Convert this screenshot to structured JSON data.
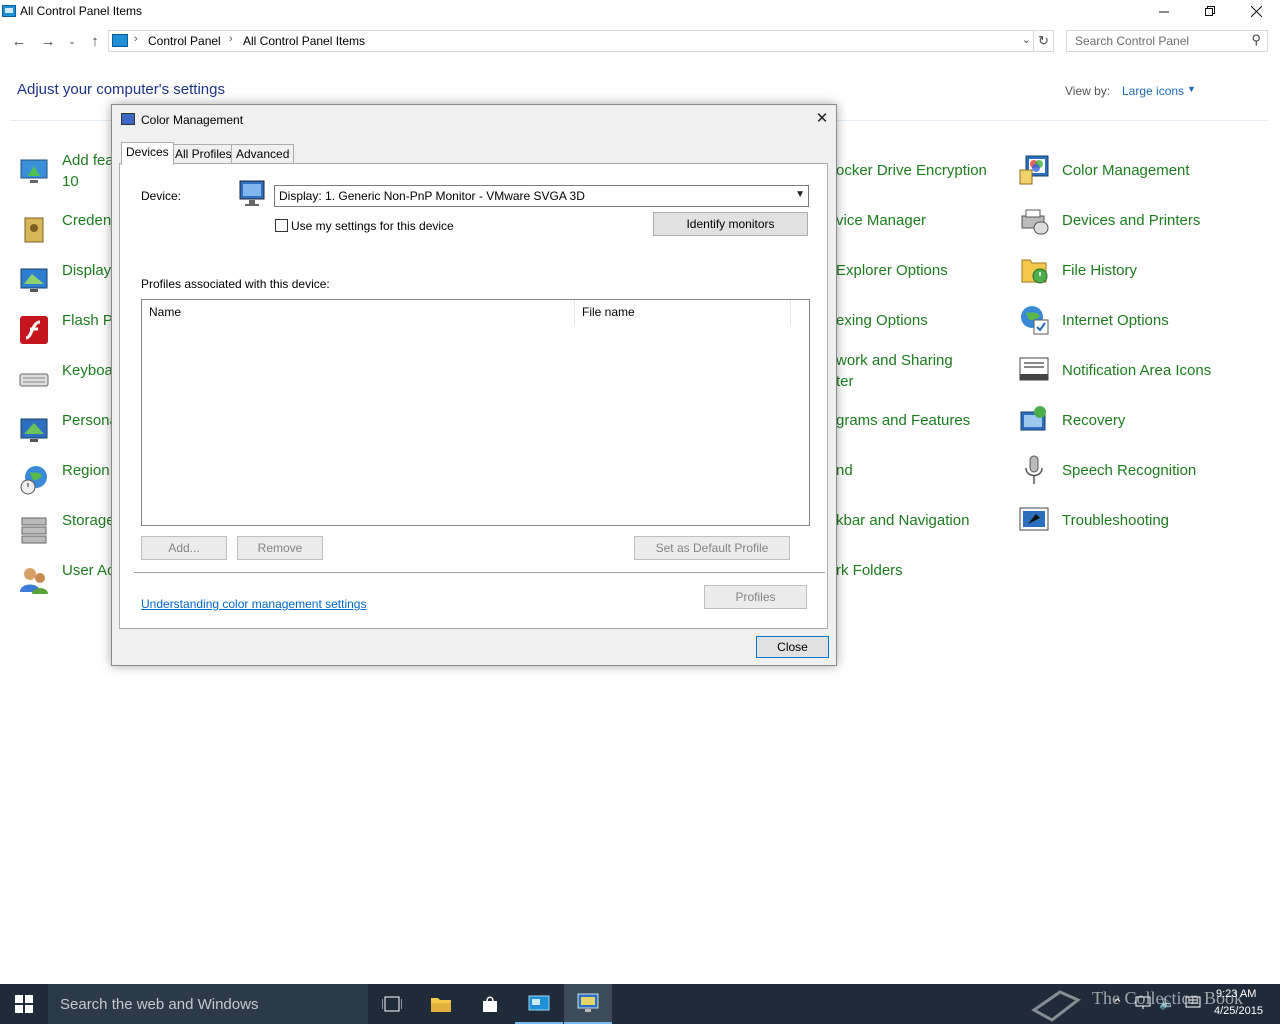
{
  "window": {
    "title": "All Control Panel Items"
  },
  "address": {
    "crumbs": [
      "Control Panel",
      "All Control Panel Items"
    ],
    "search_placeholder": "Search Control Panel"
  },
  "content": {
    "heading": "Adjust your computer's settings",
    "view_by_label": "View by:",
    "view_by_value": "Large icons"
  },
  "items": {
    "col1": [
      {
        "label": "Add fea",
        "label2": "10",
        "icon": "add-features-icon"
      },
      {
        "label": "Creden",
        "icon": "credential-manager-icon"
      },
      {
        "label": "Display",
        "icon": "display-icon"
      },
      {
        "label": "Flash P",
        "icon": "flash-player-icon"
      },
      {
        "label": "Keyboa",
        "icon": "keyboard-icon"
      },
      {
        "label": "Persona",
        "icon": "personalization-icon"
      },
      {
        "label": "Region",
        "icon": "region-icon"
      },
      {
        "label": "Storage",
        "icon": "storage-spaces-icon"
      },
      {
        "label": "User Ac",
        "icon": "user-accounts-icon"
      }
    ],
    "col2": [
      {
        "label": "ocker Drive Encryption"
      },
      {
        "label": "vice Manager"
      },
      {
        "label": " Explorer Options"
      },
      {
        "label": "exing Options"
      },
      {
        "label": "work and Sharing",
        "label2": "ter"
      },
      {
        "label": "grams and Features"
      },
      {
        "label": "nd"
      },
      {
        "label": "kbar and Navigation"
      },
      {
        "label": "rk Folders"
      }
    ],
    "col3": [
      {
        "label": "Color Management",
        "icon": "color-management-icon"
      },
      {
        "label": "Devices and Printers",
        "icon": "devices-printers-icon"
      },
      {
        "label": "File History",
        "icon": "file-history-icon"
      },
      {
        "label": "Internet Options",
        "icon": "internet-options-icon"
      },
      {
        "label": "Notification Area Icons",
        "icon": "notification-area-icon"
      },
      {
        "label": "Recovery",
        "icon": "recovery-icon"
      },
      {
        "label": "Speech Recognition",
        "icon": "microphone-icon"
      },
      {
        "label": "Troubleshooting",
        "icon": "troubleshooting-icon"
      }
    ]
  },
  "dialog": {
    "title": "Color Management",
    "tabs": [
      "Devices",
      "All Profiles",
      "Advanced"
    ],
    "device_label": "Device:",
    "device_value": "Display: 1. Generic Non-PnP Monitor - VMware SVGA 3D",
    "checkbox_label": "Use my settings for this device",
    "checkbox_checked": false,
    "identify_button": "Identify monitors",
    "profiles_label": "Profiles associated with this device:",
    "columns": [
      "Name",
      "File name"
    ],
    "add_button": "Add...",
    "remove_button": "Remove",
    "set_default_button": "Set as Default Profile",
    "link": "Understanding color management settings",
    "profiles_button": "Profiles",
    "close_button": "Close"
  },
  "taskbar": {
    "search_text": "Search the web and Windows",
    "time": "9:23 AM",
    "date": "4/25/2015",
    "watermark": "The Collection Book"
  }
}
